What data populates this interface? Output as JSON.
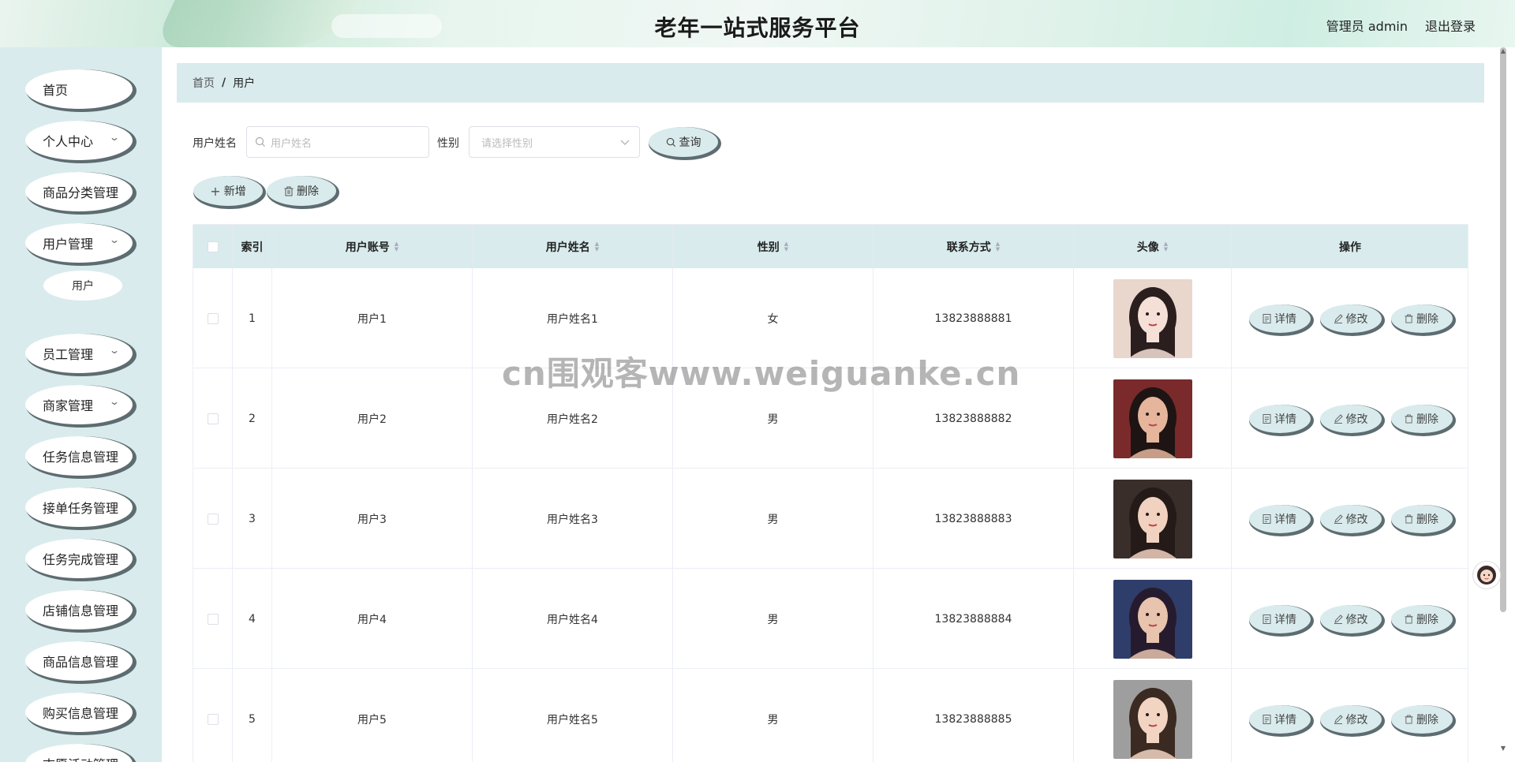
{
  "header": {
    "title": "老年一站式服务平台",
    "user_label": "管理员 admin",
    "logout_label": "退出登录"
  },
  "sidebar": {
    "items": [
      {
        "label": "首页",
        "has_arrow": false
      },
      {
        "label": "个人中心",
        "has_arrow": true
      },
      {
        "label": "商品分类管理",
        "has_arrow": false
      },
      {
        "label": "用户管理",
        "has_arrow": true
      },
      {
        "label": "员工管理",
        "has_arrow": true
      },
      {
        "label": "商家管理",
        "has_arrow": true
      },
      {
        "label": "任务信息管理",
        "has_arrow": false
      },
      {
        "label": "接单任务管理",
        "has_arrow": false
      },
      {
        "label": "任务完成管理",
        "has_arrow": false
      },
      {
        "label": "店铺信息管理",
        "has_arrow": false
      },
      {
        "label": "商品信息管理",
        "has_arrow": false
      },
      {
        "label": "购买信息管理",
        "has_arrow": false
      },
      {
        "label": "志愿活动管理",
        "has_arrow": false
      }
    ],
    "submenu": {
      "label": "用户"
    },
    "arrow_glyph": "⌄"
  },
  "breadcrumb": {
    "home": "首页",
    "separator": "/",
    "current": "用户"
  },
  "search": {
    "name_label": "用户姓名",
    "name_placeholder": "用户姓名",
    "gender_label": "性别",
    "gender_placeholder": "请选择性别",
    "query_label": "查询"
  },
  "toolbar": {
    "add_label": "新增",
    "delete_label": "删除"
  },
  "table": {
    "columns": [
      "索引",
      "用户账号",
      "用户姓名",
      "性别",
      "联系方式",
      "头像",
      "操作"
    ],
    "rows": [
      {
        "index": "1",
        "account": "用户1",
        "name": "用户姓名1",
        "gender": "女",
        "phone": "13823888881"
      },
      {
        "index": "2",
        "account": "用户2",
        "name": "用户姓名2",
        "gender": "男",
        "phone": "13823888882"
      },
      {
        "index": "3",
        "account": "用户3",
        "name": "用户姓名3",
        "gender": "男",
        "phone": "13823888883"
      },
      {
        "index": "4",
        "account": "用户4",
        "name": "用户姓名4",
        "gender": "男",
        "phone": "13823888884"
      },
      {
        "index": "5",
        "account": "用户5",
        "name": "用户姓名5",
        "gender": "男",
        "phone": "13823888885"
      }
    ],
    "actions": {
      "detail": "详情",
      "edit": "修改",
      "delete": "删除"
    }
  },
  "watermark": "cn围观客www.weiguanke.cn",
  "colors": {
    "accent_bg": "#d9ebed",
    "button_shadow": "#5d6c70"
  }
}
